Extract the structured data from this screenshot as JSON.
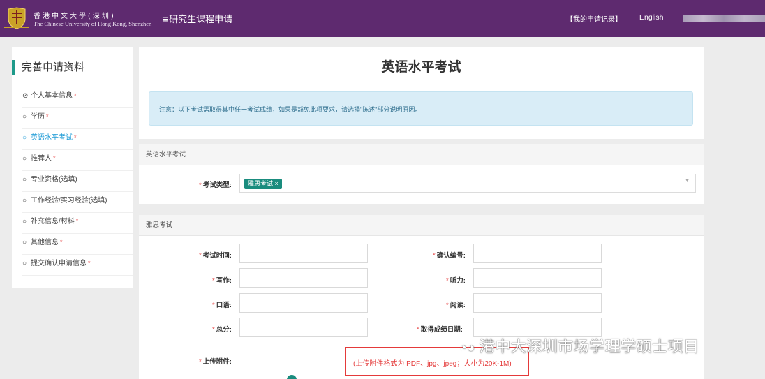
{
  "header": {
    "brand_cn": "香港中文大學(深圳)",
    "brand_en": "The Chinese University of Hong Kong, Shenzhen",
    "menu_title": "研究生课程申请",
    "records_link": "【我的申请记录】",
    "language": "English"
  },
  "sidebar": {
    "title": "完善申请资料",
    "items": [
      {
        "label": "个人基本信息",
        "marker": "⊘",
        "required": "*"
      },
      {
        "label": "学历",
        "marker": "○",
        "required": "*"
      },
      {
        "label": "英语水平考试",
        "marker": "○",
        "required": "*"
      },
      {
        "label": "推荐人",
        "marker": "○",
        "required": "*"
      },
      {
        "label": "专业资格(选填)",
        "marker": "○",
        "required": ""
      },
      {
        "label": "工作经验/实习经验(选填)",
        "marker": "○",
        "required": ""
      },
      {
        "label": "补充信息/材料",
        "marker": "○",
        "required": "*"
      },
      {
        "label": "其他信息",
        "marker": "○",
        "required": "*"
      },
      {
        "label": "提交确认申请信息",
        "marker": "○",
        "required": "*"
      }
    ]
  },
  "main": {
    "title": "英语水平考试",
    "notice": "注意：以下考试需取得其中任一考试成绩，如果是豁免此项要求，请选择\"陈述\"部分说明原因。"
  },
  "section1": {
    "heading": "英语水平考试",
    "exam_type_label": "考试类型:",
    "exam_tag": "雅思考试",
    "tag_remove": "×"
  },
  "section2": {
    "heading": "雅思考试",
    "fields": {
      "exam_time": "考试时间:",
      "confirm_no": "确认编号:",
      "writing": "写作:",
      "listening": "听力:",
      "speaking": "口语:",
      "reading": "阅读:",
      "total": "总分:",
      "score_date": "取得成绩日期:",
      "upload": "上传附件:"
    },
    "star": "*"
  },
  "annotation": {
    "hint": "(上传附件格式为 PDF、jpg、jpeg；大小为20K-1M)",
    "watermark": "港中大深圳市场学理学硕士项目"
  }
}
